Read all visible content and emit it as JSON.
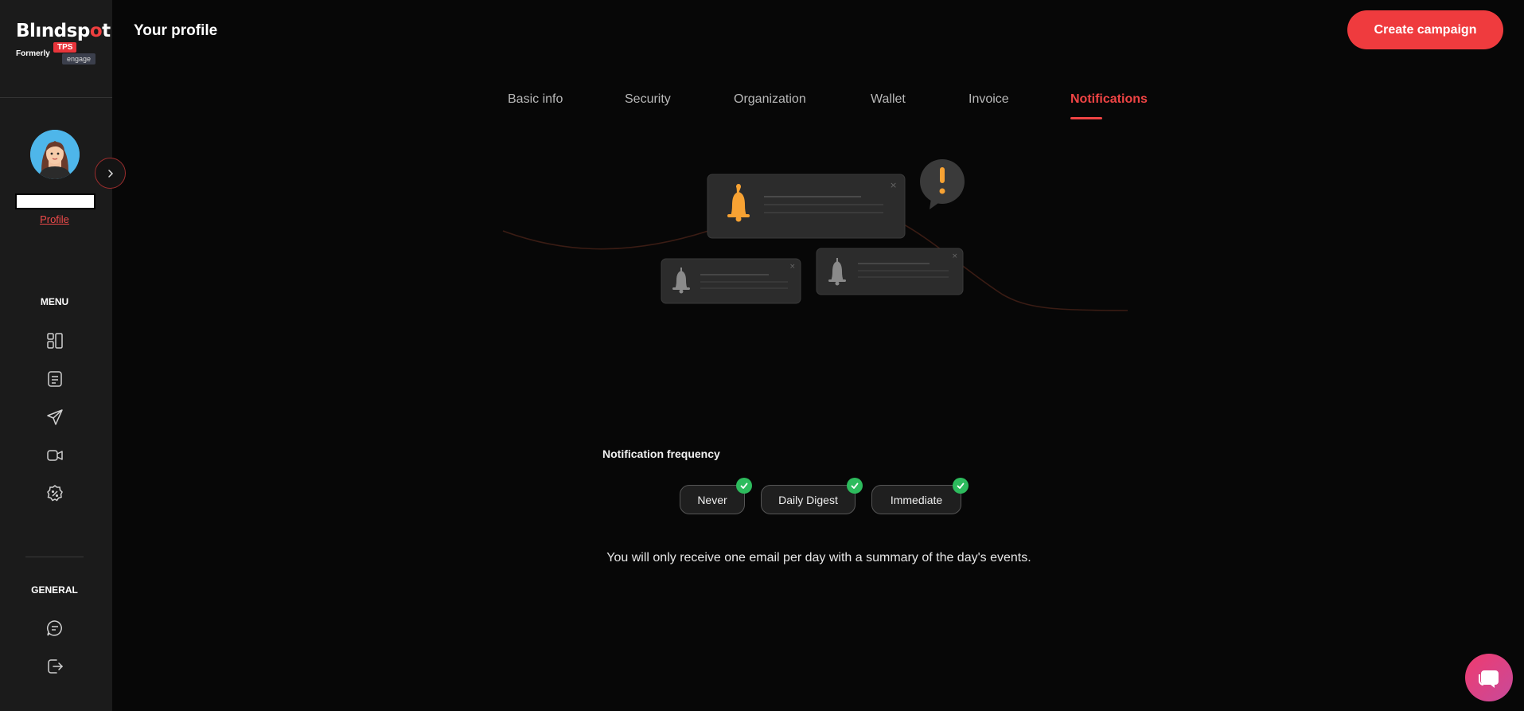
{
  "brand": {
    "name_prefix": "Bl",
    "name_middle": "ndsp",
    "name_dot": "o",
    "name_end": "t",
    "formerly": "Formerly",
    "tps": "TPS",
    "engage": "engage"
  },
  "sidebar": {
    "profile_link": "Profile",
    "menu_heading": "MENU",
    "general_heading": "GENERAL",
    "menu_icons": [
      "dashboard-icon",
      "list-icon",
      "send-icon",
      "video-icon",
      "discount-icon"
    ],
    "general_icons": [
      "chat-bubble-icon",
      "logout-icon"
    ]
  },
  "header": {
    "title": "Your profile",
    "create_button": "Create campaign"
  },
  "tabs": [
    {
      "label": "Basic info",
      "active": false
    },
    {
      "label": "Security",
      "active": false
    },
    {
      "label": "Organization",
      "active": false
    },
    {
      "label": "Wallet",
      "active": false
    },
    {
      "label": "Invoice",
      "active": false
    },
    {
      "label": "Notifications",
      "active": true
    }
  ],
  "notifications": {
    "frequency_label": "Notification frequency",
    "options": [
      "Never",
      "Daily Digest",
      "Immediate"
    ],
    "description": "You will only receive one email per day with a summary of the day's events."
  },
  "colors": {
    "accent": "#ef3b3e",
    "sidebar_bg": "#1b1b1b",
    "page_bg": "#070707",
    "check_green": "#2dbb5d",
    "bell_orange": "#f7a233"
  }
}
